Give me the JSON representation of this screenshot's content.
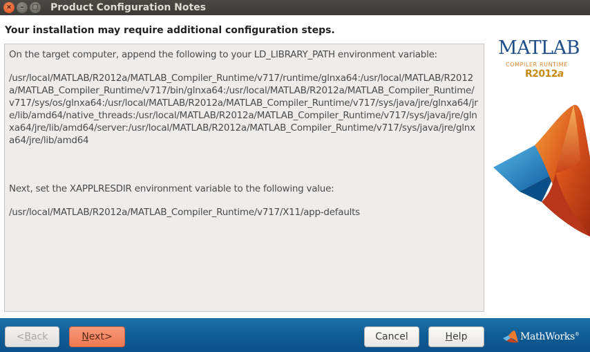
{
  "window": {
    "title": "Product Configuration Notes",
    "controls": {
      "close": "×",
      "minimize": "–",
      "maximize": "□"
    }
  },
  "main": {
    "heading": "Your installation may require additional configuration steps.",
    "notes": {
      "ld_intro": "On the target computer, append the following to your LD_LIBRARY_PATH environment variable:",
      "ld_path": "/usr/local/MATLAB/R2012a/MATLAB_Compiler_Runtime/v717/runtime/glnxa64:/usr/local/MATLAB/R2012a/MATLAB_Compiler_Runtime/v717/bin/glnxa64:/usr/local/MATLAB/R2012a/MATLAB_Compiler_Runtime/v717/sys/os/glnxa64:/usr/local/MATLAB/R2012a/MATLAB_Compiler_Runtime/v717/sys/java/jre/glnxa64/jre/lib/amd64/native_threads:/usr/local/MATLAB/R2012a/MATLAB_Compiler_Runtime/v717/sys/java/jre/glnxa64/jre/lib/amd64/server:/usr/local/MATLAB/R2012a/MATLAB_Compiler_Runtime/v717/sys/java/jre/glnxa64/jre/lib/amd64",
      "xappl_intro": "Next, set the XAPPLRESDIR environment variable to the following value:",
      "xappl_path": "/usr/local/MATLAB/R2012a/MATLAB_Compiler_Runtime/v717/X11/app-defaults"
    }
  },
  "branding": {
    "product": "MATLAB",
    "subtitle": "COMPILER RUNTIME",
    "release_prefix": "R2012",
    "release_suffix": "a",
    "company": "MathWorks",
    "company_mark": "®"
  },
  "buttons": {
    "back": {
      "prefix": "< ",
      "mnemonic": "B",
      "rest": "ack",
      "enabled": false
    },
    "next": {
      "mnemonic": "N",
      "rest": "ext",
      "suffix": " >",
      "enabled": true
    },
    "cancel": {
      "label": "Cancel"
    },
    "help": {
      "mnemonic": "H",
      "rest": "elp"
    }
  },
  "colors": {
    "titlebar": "#3c3b37",
    "bottombar": "#0f5a92",
    "next_button": "#f0784f",
    "matlab_blue": "#1f4f8a",
    "release_gold": "#c98a14"
  },
  "icons": {
    "close": "window-close-icon",
    "minimize": "window-minimize-icon",
    "maximize": "window-maximize-icon",
    "membrane": "matlab-membrane-logo",
    "mathworks": "mathworks-logo-icon"
  }
}
